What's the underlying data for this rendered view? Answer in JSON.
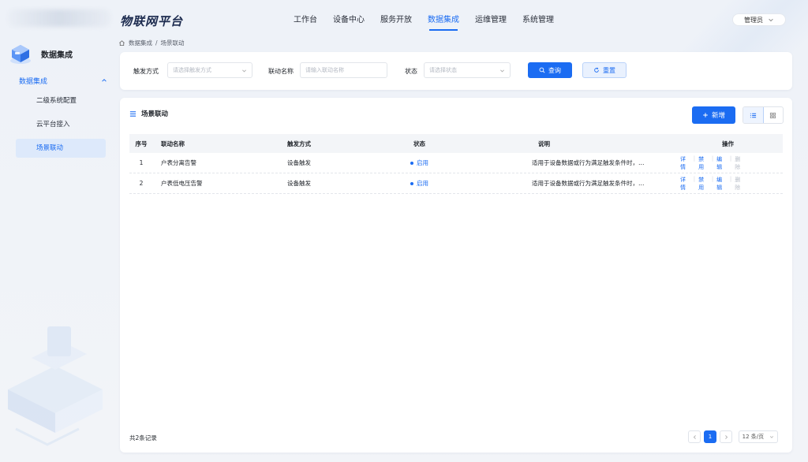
{
  "header": {
    "brand": "物联网平台",
    "nav": [
      {
        "label": "工作台",
        "active": false
      },
      {
        "label": "设备中心",
        "active": false
      },
      {
        "label": "服务开放",
        "active": false
      },
      {
        "label": "数据集成",
        "active": true
      },
      {
        "label": "运维管理",
        "active": false
      },
      {
        "label": "系统管理",
        "active": false
      }
    ],
    "user": "管理员"
  },
  "sidebar": {
    "title": "数据集成",
    "group": "数据集成",
    "items": [
      {
        "label": "二级系统配置",
        "active": false
      },
      {
        "label": "云平台接入",
        "active": false
      },
      {
        "label": "场景联动",
        "active": true
      }
    ]
  },
  "breadcrumb": {
    "root": "数据集成",
    "separator": "/",
    "current": "场景联动"
  },
  "filters": {
    "trigger_label": "触发方式",
    "trigger_placeholder": "请选择触发方式",
    "name_label": "联动名称",
    "name_placeholder": "请输入联动名称",
    "status_label": "状态",
    "status_placeholder": "请选择状态",
    "query_button": "查询",
    "reset_button": "重置"
  },
  "card": {
    "title": "场景联动",
    "add_button": "新增"
  },
  "table": {
    "headers": {
      "index": "序号",
      "name": "联动名称",
      "trigger": "触发方式",
      "status": "状态",
      "desc": "说明",
      "ops": "操作"
    },
    "rows": [
      {
        "index": "1",
        "name": "户表分离告警",
        "trigger": "设备触发",
        "status": "启用",
        "desc": "适用于设备数据或行为满足触发条件时，…",
        "ops": {
          "detail": "详情",
          "disable": "禁用",
          "edit": "编辑",
          "delete": "删除"
        }
      },
      {
        "index": "2",
        "name": "户表低电压告警",
        "trigger": "设备触发",
        "status": "启用",
        "desc": "适用于设备数据或行为满足触发条件时，…",
        "ops": {
          "detail": "详情",
          "disable": "禁用",
          "edit": "编辑",
          "delete": "删除"
        }
      }
    ]
  },
  "footer": {
    "total": "共2条记录",
    "current_page": "1",
    "page_size": "12 条/页"
  },
  "colors": {
    "primary": "#1b6cf2",
    "active_bg": "#dde9fb"
  },
  "icons": {
    "home": "home-icon",
    "search": "search-icon",
    "reset": "refresh-icon",
    "plus": "plus-icon",
    "list": "list-view-icon",
    "grid": "grid-view-icon"
  }
}
